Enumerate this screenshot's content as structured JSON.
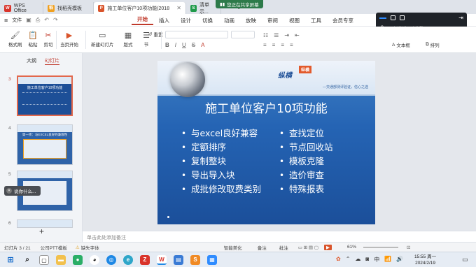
{
  "tabs": [
    {
      "label": "WPS Office",
      "icon": "wps-logo-icon",
      "active": false
    },
    {
      "label": "找稻壳模板",
      "icon": "docer-icon",
      "active": false
    },
    {
      "label": "施工单位客户10项功能(2018...",
      "icon": "ppt-icon",
      "active": true
    },
    {
      "label": "清单示...",
      "icon": "sheet-icon",
      "active": false
    }
  ],
  "share_badge": "您正在共享屏幕",
  "menubar": {
    "file": "文件",
    "menus": [
      "开始",
      "插入",
      "设计",
      "切换",
      "动画",
      "放映",
      "审阅",
      "视图",
      "工具",
      "会员专享"
    ],
    "active_menu": "开始"
  },
  "ribbon": {
    "format_painter": "格式刷",
    "paste": "粘贴",
    "cut": "剪切",
    "from_current": "当页开始",
    "new_slide": "新建幻灯片",
    "layout": "版式",
    "section": "节",
    "reset": "重置",
    "textbox": "文本框",
    "arrange": "排列"
  },
  "meeting": {
    "speaking_label": "正在讲话:",
    "speaker": "孙燕鹏;"
  },
  "panel": {
    "tabs": [
      "大纲",
      "幻灯片"
    ],
    "active_tab": "幻灯片",
    "slides": [
      {
        "num": "3",
        "title": "施工单位客户10项功能"
      },
      {
        "num": "4",
        "title": "第一项：与EXCEL良好的兼容性"
      },
      {
        "num": "5",
        "title": ""
      },
      {
        "num": "6",
        "title": ""
      }
    ],
    "tooltip": "说你什么..."
  },
  "slide": {
    "badge": "纵横",
    "logo": "纵横",
    "tagline": "—交通部测评验证，信心之选",
    "title": "施工单位客户10项功能",
    "left_items": [
      "与excel良好兼容",
      "定额排序",
      "复制整块",
      "导出导入块",
      "成批修改取费类别"
    ],
    "right_items": [
      "查找定位",
      "节点回收站",
      "模板克隆",
      "造价审查",
      "特殊报表"
    ]
  },
  "notes_placeholder": "单击此处添加备注",
  "status": {
    "slide_count": "幻灯片 3 / 21",
    "theme": "公司PTT模板",
    "missing_font": "缺失字体",
    "smart_beautify": "智能美化",
    "notes": "备注",
    "comments": "批注",
    "zoom": "61%"
  },
  "clock": {
    "time": "15:55 周一",
    "date": "2024/2/19"
  },
  "colors": {
    "accent_red": "#c0392b",
    "slide_blue": "#1d4f97",
    "share_green": "#2d7a4a"
  }
}
